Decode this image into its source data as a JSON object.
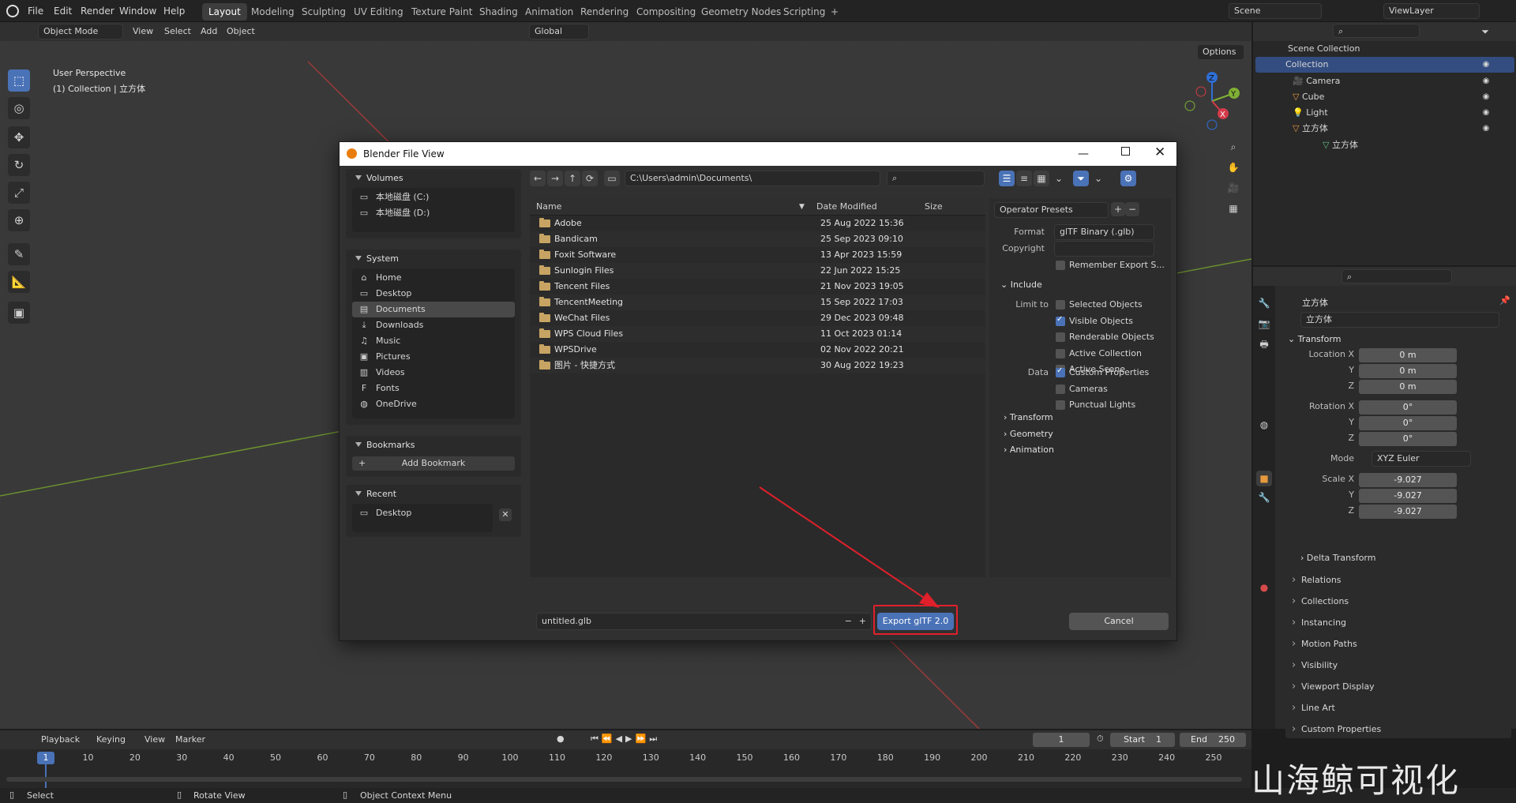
{
  "topbar": {
    "menus": [
      "File",
      "Edit",
      "Render",
      "Window",
      "Help"
    ],
    "workspaces": [
      "Layout",
      "Modeling",
      "Sculpting",
      "UV Editing",
      "Texture Paint",
      "Shading",
      "Animation",
      "Rendering",
      "Compositing",
      "Geometry Nodes",
      "Scripting"
    ],
    "active_workspace": "Layout",
    "scene": "Scene",
    "view_layer": "ViewLayer"
  },
  "viewport": {
    "mode": "Object Mode",
    "menus": [
      "View",
      "Select",
      "Add",
      "Object"
    ],
    "orientation": "Global",
    "options": "Options",
    "perspective": "User Perspective",
    "collection_info": "(1) Collection | 立方体"
  },
  "dialog": {
    "title": "Blender File View",
    "path": "C:\\Users\\admin\\Documents\\",
    "search_placeholder": "",
    "volumes": {
      "header": "Volumes",
      "items": [
        "本地磁盘 (C:)",
        "本地磁盘 (D:)"
      ]
    },
    "system": {
      "header": "System",
      "items": [
        "Home",
        "Desktop",
        "Documents",
        "Downloads",
        "Music",
        "Pictures",
        "Videos",
        "Fonts",
        "OneDrive"
      ],
      "selected": "Documents"
    },
    "bookmarks": {
      "header": "Bookmarks",
      "add": "Add Bookmark"
    },
    "recent": {
      "header": "Recent",
      "items": [
        "Desktop"
      ]
    },
    "columns": {
      "name": "Name",
      "date": "Date Modified",
      "size": "Size"
    },
    "files": [
      {
        "name": "Adobe",
        "date": "25 Aug 2022 15:36"
      },
      {
        "name": "Bandicam",
        "date": "25 Sep 2023 09:10"
      },
      {
        "name": "Foxit Software",
        "date": "13 Apr 2023 15:59"
      },
      {
        "name": "Sunlogin Files",
        "date": "22 Jun 2022 15:25"
      },
      {
        "name": "Tencent Files",
        "date": "21 Nov 2023 19:05"
      },
      {
        "name": "TencentMeeting",
        "date": "15 Sep 2022 17:03"
      },
      {
        "name": "WeChat Files",
        "date": "29 Dec 2023 09:48"
      },
      {
        "name": "WPS Cloud Files",
        "date": "11 Oct 2023 01:14"
      },
      {
        "name": "WPSDrive",
        "date": "02 Nov 2022 20:21"
      },
      {
        "name": "图片 - 快捷方式",
        "date": "30 Aug 2022 19:23"
      }
    ],
    "filename": "untitled.glb",
    "export_button": "Export glTF 2.0",
    "cancel_button": "Cancel",
    "operator_presets": "Operator Presets",
    "format_label": "Format",
    "format_value": "glTF Binary (.glb)",
    "copyright_label": "Copyright",
    "remember": "Remember Export S...",
    "include_header": "Include",
    "limit_to_label": "Limit to",
    "limit_to": [
      {
        "label": "Selected Objects",
        "checked": false
      },
      {
        "label": "Visible Objects",
        "checked": true
      },
      {
        "label": "Renderable Objects",
        "checked": false
      },
      {
        "label": "Active Collection",
        "checked": false
      },
      {
        "label": "Active Scene",
        "checked": false
      }
    ],
    "data_label": "Data",
    "data": [
      {
        "label": "Custom Properties",
        "checked": true
      },
      {
        "label": "Cameras",
        "checked": false
      },
      {
        "label": "Punctual Lights",
        "checked": false
      }
    ],
    "sections": [
      "Transform",
      "Geometry",
      "Animation"
    ]
  },
  "outliner": {
    "root": "Scene Collection",
    "collection": "Collection",
    "items": [
      "Camera",
      "Cube",
      "Light",
      "立方体"
    ],
    "child": "立方体"
  },
  "properties": {
    "object_name": "立方体",
    "data_name": "立方体",
    "transform_header": "Transform",
    "location_label": "Location X",
    "location": [
      "0 m",
      "0 m",
      "0 m"
    ],
    "rotation_label": "Rotation X",
    "rotation": [
      "0°",
      "0°",
      "0°"
    ],
    "mode_label": "Mode",
    "mode_value": "XYZ Euler",
    "scale_label": "Scale X",
    "scale": [
      "-9.027",
      "-9.027",
      "-9.027"
    ],
    "axis_y": "Y",
    "axis_z": "Z",
    "delta": "Delta Transform",
    "sections": [
      "Relations",
      "Collections",
      "Instancing",
      "Motion Paths",
      "Visibility",
      "Viewport Display",
      "Line Art",
      "Custom Properties"
    ]
  },
  "timeline": {
    "menus": [
      "Playback",
      "Keying",
      "View",
      "Marker"
    ],
    "current_frame": "1",
    "start_label": "Start",
    "start": "1",
    "end_label": "End",
    "end": "250",
    "ticks": [
      "1",
      "10",
      "20",
      "30",
      "40",
      "50",
      "60",
      "70",
      "80",
      "90",
      "100",
      "110",
      "120",
      "130",
      "140",
      "150",
      "160",
      "170",
      "180",
      "190",
      "200",
      "210",
      "220",
      "230",
      "240",
      "250"
    ]
  },
  "statusbar": {
    "select": "Select",
    "rotate": "Rotate View",
    "context": "Object Context Menu"
  },
  "watermark": "山海鲸可视化",
  "colors": {
    "accent": "#4a72b7",
    "highlight": "#e0202a"
  }
}
